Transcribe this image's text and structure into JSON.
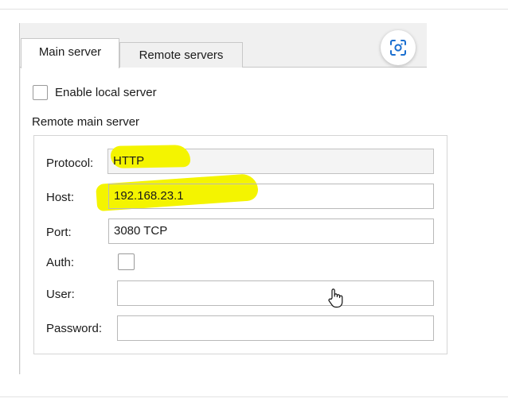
{
  "tabs": [
    {
      "label": "Main server",
      "active": true
    },
    {
      "label": "Remote servers",
      "active": false
    }
  ],
  "enable_local_server": {
    "label": "Enable local server",
    "checked": false
  },
  "group_title": "Remote main server",
  "form": {
    "protocol": {
      "label": "Protocol:",
      "value": "HTTP"
    },
    "host": {
      "label": "Host:",
      "value": "192.168.23.1"
    },
    "port": {
      "label": "Port:",
      "value": "3080 TCP"
    },
    "auth": {
      "label": "Auth:",
      "checked": false
    },
    "user": {
      "label": "User:",
      "value": ""
    },
    "password": {
      "label": "Password:",
      "value": ""
    }
  },
  "icons": {
    "lens": "visual-search-icon",
    "pointer": "hand-pointer-icon"
  },
  "colors": {
    "highlight": "#f4f400",
    "window_bg": "#f0f0f0"
  }
}
